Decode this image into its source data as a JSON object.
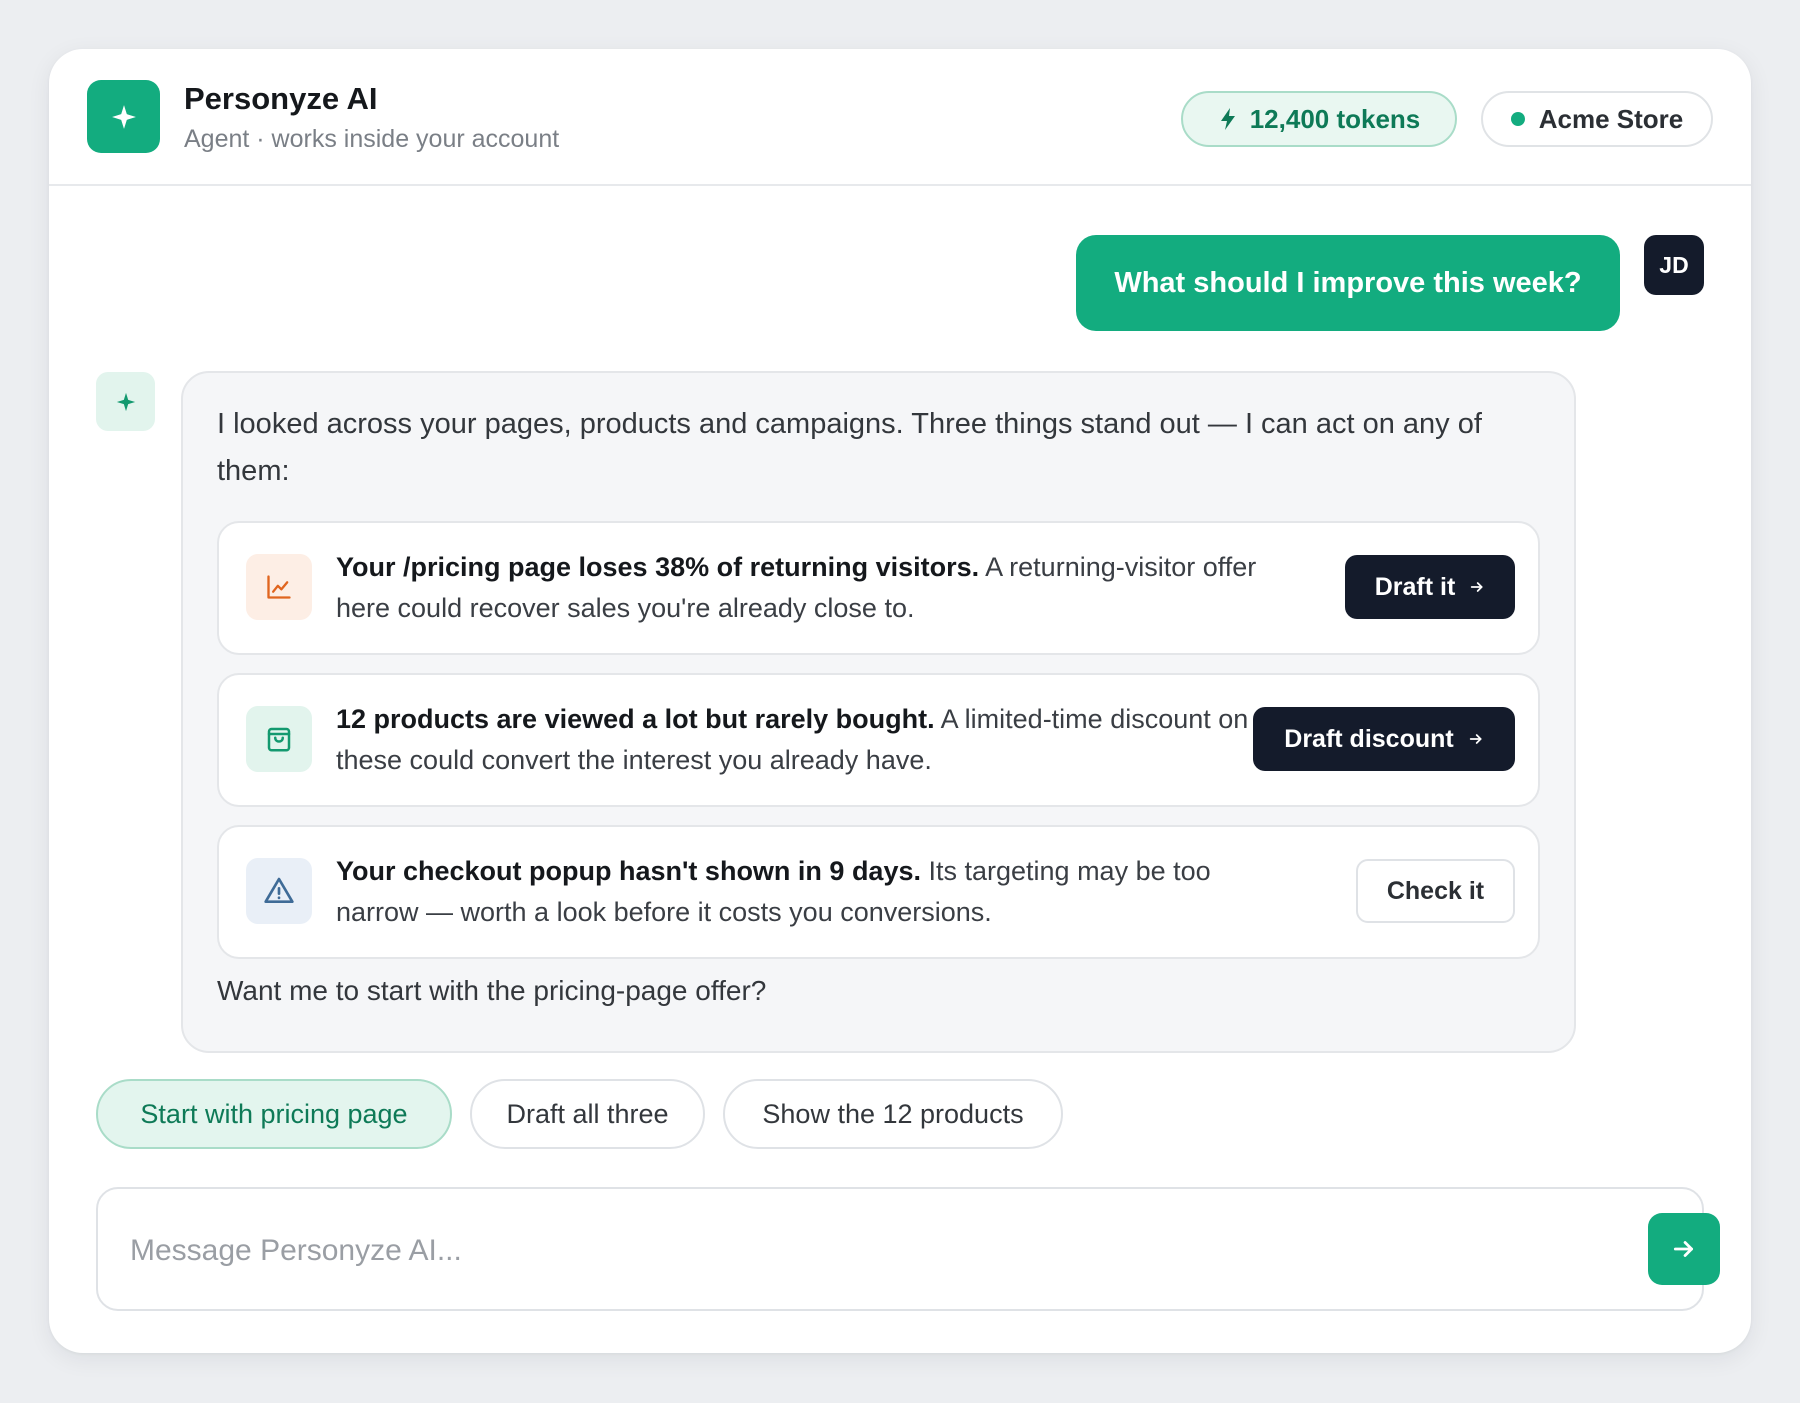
{
  "header": {
    "title": "Personyze AI",
    "subtitle": "Agent · works inside your account",
    "tokens_label": "12,400 tokens",
    "store_label": "Acme Store"
  },
  "user": {
    "avatar_initials": "JD",
    "message": "What should I improve this week?"
  },
  "agent": {
    "intro": "I looked across your pages, products and campaigns. Three things stand out — I can act on any of them:",
    "items": [
      {
        "icon": "chart-line-icon",
        "headline": "Your /pricing page loses 38% of returning visitors.",
        "detail": " A returning-visitor offer here could recover sales you're already close to.",
        "action": "Draft it",
        "action_style": "dark",
        "accent": "#e0651f",
        "icon_bg": "#fdeee5"
      },
      {
        "icon": "shopping-bag-icon",
        "headline": "12 products are viewed a lot but rarely bought.",
        "detail": " A limited-time discount on these could convert the interest you already have.",
        "action": "Draft discount",
        "action_style": "dark",
        "accent": "#13996f",
        "icon_bg": "#e2f4ed"
      },
      {
        "icon": "warning-triangle-icon",
        "headline": "Your checkout popup hasn't shown in 9 days.",
        "detail": " Its targeting may be too narrow — worth a look before it costs you conversions.",
        "action": "Check it",
        "action_style": "light",
        "accent": "#3f6b97",
        "icon_bg": "#e9eff7"
      }
    ],
    "outro": "Want me to start with the pricing-page offer?"
  },
  "suggestions": [
    "Start with pricing page",
    "Draft all three",
    "Show the 12 products"
  ],
  "composer": {
    "placeholder": "Message Personyze AI...",
    "value": ""
  },
  "colors": {
    "brand": "#13ac7f",
    "dark": "#141b2b"
  }
}
